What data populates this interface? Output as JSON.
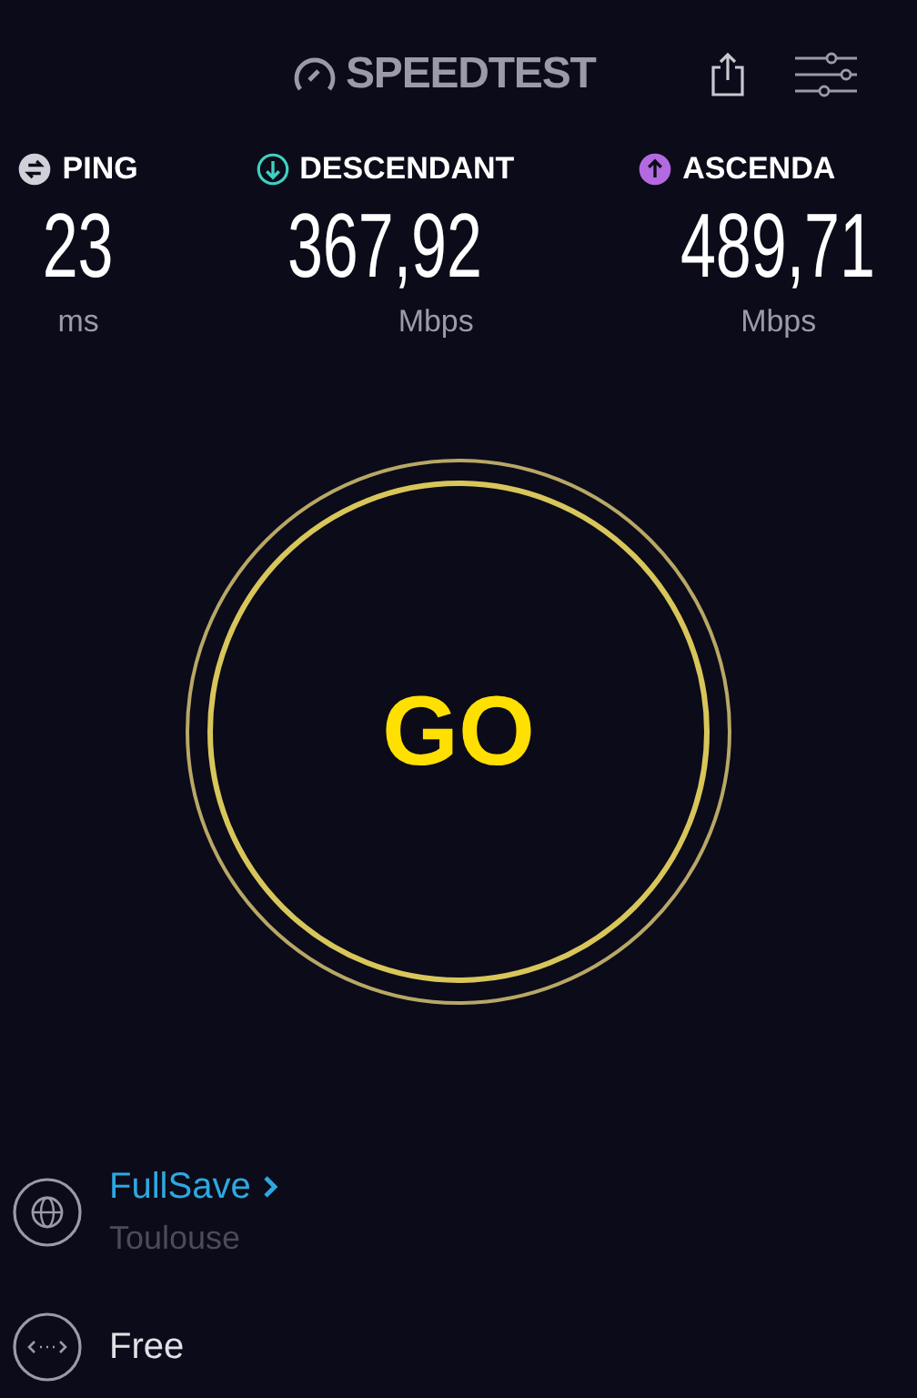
{
  "header": {
    "logo": "SPEEDTEST"
  },
  "metrics": [
    {
      "kind": "ping",
      "label": "PING",
      "value": "23",
      "unit": "ms",
      "color": "#d0d0d8"
    },
    {
      "kind": "download",
      "label": "DESCENDANT",
      "value": "367,92",
      "unit": "Mbps",
      "color": "#3fd1c2"
    },
    {
      "kind": "upload",
      "label": "ASCENDA",
      "value": "489,71",
      "unit": "Mbps",
      "color": "#b36ae0"
    }
  ],
  "go_button": {
    "label": "GO"
  },
  "server": {
    "provider": "FullSave",
    "location": "Toulouse"
  },
  "isp": {
    "name": "Free"
  }
}
